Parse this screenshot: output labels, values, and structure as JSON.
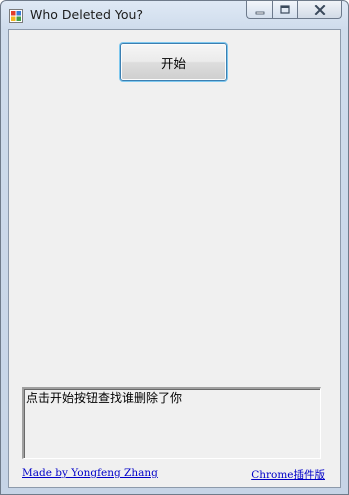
{
  "window": {
    "title": "Who Deleted You?",
    "icon": "app-window-icon"
  },
  "caption_buttons": {
    "minimize_icon": "minimize-icon",
    "maximize_icon": "maximize-icon",
    "close_icon": "close-icon"
  },
  "main": {
    "start_label": "开始",
    "result_text": "点击开始按钮查找谁删除了你"
  },
  "footer": {
    "author_link": "Made by Yongfeng Zhang",
    "chrome_link": "Chrome插件版"
  },
  "colors": {
    "link": "#0000c8",
    "client_bg": "#f0f0f0",
    "button_border": "#3c7fb1"
  }
}
